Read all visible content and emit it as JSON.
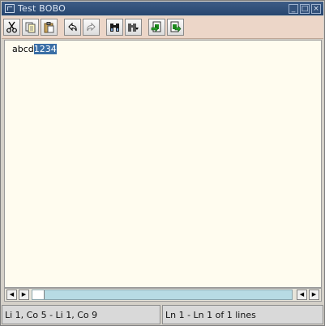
{
  "window": {
    "title": "Test BOBO"
  },
  "title_buttons": [
    {
      "name": "minimize-button",
      "glyph": "_"
    },
    {
      "name": "maximize-button",
      "glyph": "□"
    },
    {
      "name": "close-button",
      "glyph": "×"
    }
  ],
  "toolbar": {
    "buttons": [
      {
        "name": "cut-button",
        "icon": "scissors-icon"
      },
      {
        "name": "copy-button",
        "icon": "copy-icon"
      },
      {
        "name": "paste-button",
        "icon": "paste-icon"
      },
      {
        "name": "undo-button",
        "icon": "undo-icon"
      },
      {
        "name": "redo-button",
        "icon": "redo-icon"
      },
      {
        "name": "find-button",
        "icon": "binoculars-icon"
      },
      {
        "name": "find-next-button",
        "icon": "binoculars-next-icon"
      },
      {
        "name": "import-button",
        "icon": "import-icon"
      },
      {
        "name": "export-button",
        "icon": "export-icon"
      }
    ]
  },
  "editor": {
    "text_before": "abcd",
    "text_selected": "1234"
  },
  "status": {
    "selection": "Li 1, Co 5 - Li 1, Co 9",
    "lines": "Ln 1 - Ln 1 of 1 lines"
  },
  "scrollbar": {
    "left_arrow": "◀",
    "right_arrow": "▶"
  },
  "colors": {
    "titlebar": "#2f4f7a",
    "toolbar": "#ecd6c8",
    "editor_bg": "#fffcef",
    "selection": "#3a6ea5",
    "scroll_track": "#b7dbe4"
  }
}
